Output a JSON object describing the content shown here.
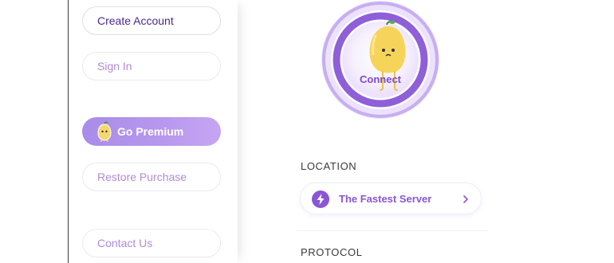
{
  "sidebar": {
    "create_account": "Create Account",
    "sign_in": "Sign In",
    "go_premium": "Go Premium",
    "restore_purchase": "Restore Purchase",
    "contact_us": "Contact Us"
  },
  "connect": {
    "label": "Connect"
  },
  "location": {
    "heading": "LOCATION",
    "server": "The Fastest Server"
  },
  "protocol": {
    "heading": "PROTOCOL"
  },
  "colors": {
    "accent": "#8a56d6",
    "premium_gradient_start": "#a98ce8",
    "premium_gradient_end": "#c6a6f2",
    "connect_text": "#7d48d4"
  },
  "icons": {
    "premium": "pear-mascot-icon",
    "location": "lightning-bolt-icon",
    "location_chevron": "chevron-right-icon"
  }
}
